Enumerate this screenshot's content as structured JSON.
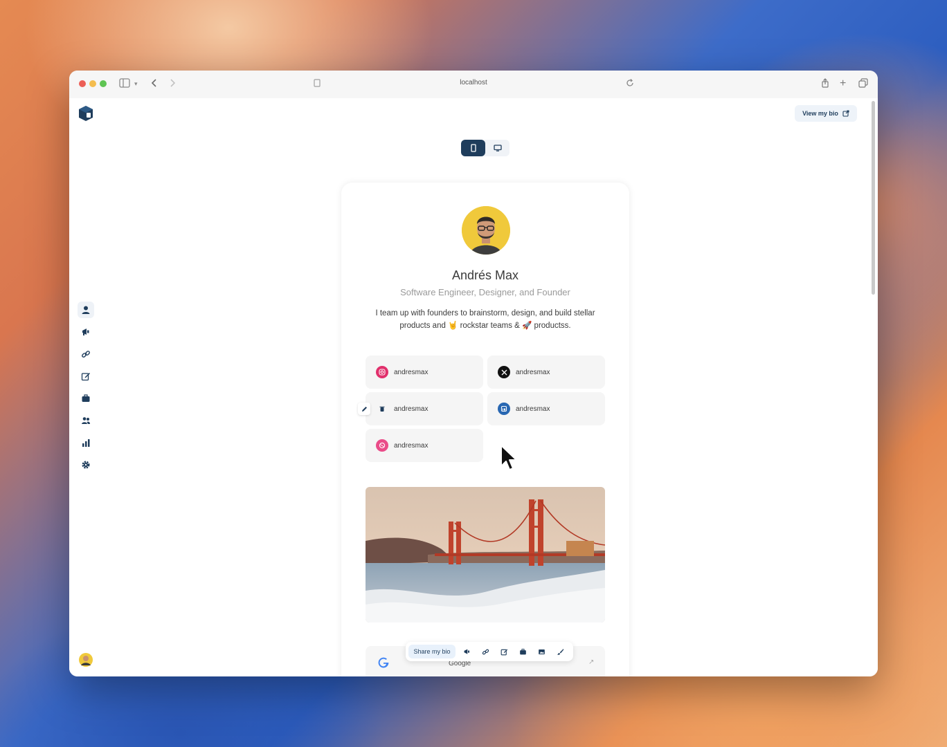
{
  "browser": {
    "url": "localhost"
  },
  "header": {
    "view_bio_label": "View my bio"
  },
  "sidebar": {
    "items": [
      "profile",
      "announcements",
      "links",
      "edit",
      "portfolio",
      "team",
      "analytics",
      "settings"
    ]
  },
  "profile": {
    "name": "Andrés Max",
    "role": "Software Engineer, Designer, and Founder",
    "description": "I team up with founders to brainstorm, design, and build stellar products and 🤘 rockstar teams & 🚀 productss."
  },
  "socials": [
    {
      "network": "instagram",
      "handle": "andresmax",
      "color": "#e1306c"
    },
    {
      "network": "x",
      "handle": "andresmax",
      "color": "#111111"
    },
    {
      "network": "threads",
      "handle": "andresmax",
      "color": "#e1306c"
    },
    {
      "network": "linkedin",
      "handle": "andresmax",
      "color": "#2867b2"
    },
    {
      "network": "dribbble",
      "handle": "andresmax",
      "color": "#ea4c89"
    }
  ],
  "bottom_card": {
    "title": "Google"
  },
  "toolbar": {
    "share_label": "Share my bio"
  }
}
